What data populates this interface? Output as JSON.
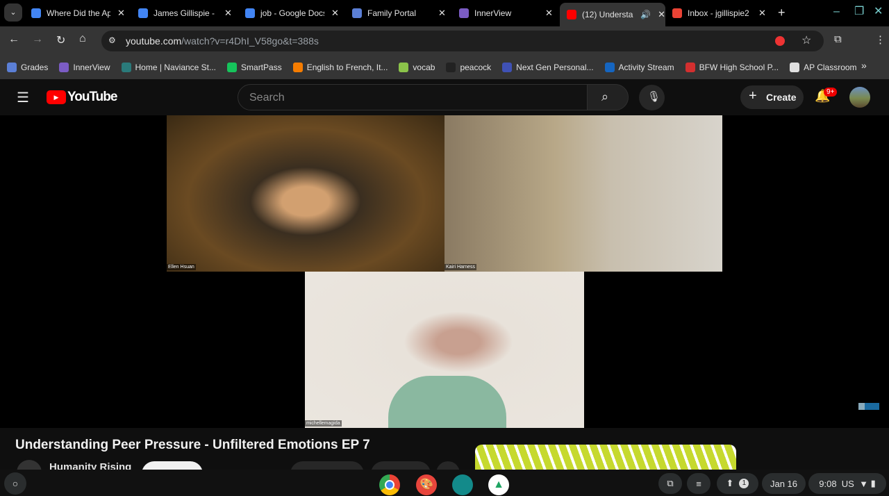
{
  "tabs": [
    {
      "title": "Where Did the Ap",
      "icon": "google-classroom-icon",
      "color": "#4285f4"
    },
    {
      "title": "James Gillispie -",
      "icon": "google-docs-icon",
      "color": "#4285f4"
    },
    {
      "title": "job - Google Docs",
      "icon": "google-docs-icon",
      "color": "#4285f4"
    },
    {
      "title": "Family Portal",
      "icon": "family-portal-icon",
      "color": "#5b7fd6"
    },
    {
      "title": "InnerView",
      "icon": "innerview-icon",
      "color": "#7b5cc4"
    },
    {
      "title": "(12) Understa",
      "icon": "youtube-icon",
      "color": "#ff0000",
      "active": true
    },
    {
      "title": "Inbox - jgillispie2",
      "icon": "gmail-icon",
      "color": "#ea4335"
    }
  ],
  "address": {
    "domain": "youtube.com",
    "path": "/watch?v=r4DhI_V58go&t=388s"
  },
  "bookmarks": [
    {
      "label": "Grades",
      "color": "#5b7fd6"
    },
    {
      "label": "InnerView",
      "color": "#7b5cc4"
    },
    {
      "label": "Home | Naviance St...",
      "color": "#2a7a7a"
    },
    {
      "label": "SmartPass",
      "color": "#16c35b"
    },
    {
      "label": "English to French, It...",
      "color": "#f57c00"
    },
    {
      "label": "vocab",
      "color": "#8bc34a"
    },
    {
      "label": "peacock",
      "color": "#222222"
    },
    {
      "label": "Next Gen Personal...",
      "color": "#3f51b5"
    },
    {
      "label": "Activity Stream",
      "color": "#1565c0"
    },
    {
      "label": "BFW High School P...",
      "color": "#d32f2f"
    },
    {
      "label": "AP Classroom",
      "color": "#e0e0e0"
    }
  ],
  "youtube": {
    "logo": "YouTube",
    "search_placeholder": "Search",
    "create_label": "Create",
    "notif_badge": "9+"
  },
  "participants": [
    "Ellen Hsuan",
    "Kairi Harness",
    "michellemagida"
  ],
  "video": {
    "title": "Understanding Peer Pressure - Unfiltered Emotions EP 7",
    "channel": "Humanity Rising"
  },
  "shelf": {
    "date": "Jan 16",
    "time": "9:08",
    "locale": "US",
    "notif_count": "1"
  }
}
